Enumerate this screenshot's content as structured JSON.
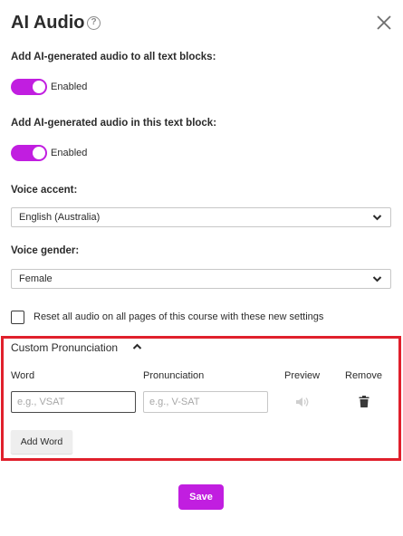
{
  "dialog": {
    "title": "AI Audio",
    "help_glyph": "?"
  },
  "all_blocks": {
    "label": "Add AI-generated audio to all text blocks:",
    "toggle_on": true,
    "status": "Enabled"
  },
  "this_block": {
    "label": "Add AI-generated audio in this text block:",
    "toggle_on": true,
    "status": "Enabled"
  },
  "voice_accent": {
    "label": "Voice accent:",
    "value": "English (Australia)"
  },
  "voice_gender": {
    "label": "Voice gender:",
    "value": "Female"
  },
  "reset": {
    "checked": false,
    "label": "Reset all audio on all pages of this course with these new settings"
  },
  "pronunciation": {
    "title": "Custom Pronunciation",
    "expanded": true,
    "columns": {
      "word": "Word",
      "pronunciation": "Pronunciation",
      "preview": "Preview",
      "remove": "Remove"
    },
    "row": {
      "word_value": "",
      "word_placeholder": "e.g., VSAT",
      "pronunciation_value": "",
      "pronunciation_placeholder": "e.g., V-SAT"
    },
    "add_label": "Add Word"
  },
  "save_label": "Save",
  "colors": {
    "accent": "#c11ee0",
    "highlight_border": "#e0202c"
  },
  "icons": {
    "help": "help-circle-icon",
    "close": "close-icon",
    "select": "chevron-down-icon",
    "collapse": "chevron-up-icon",
    "preview": "speaker-icon",
    "remove": "trash-icon"
  }
}
